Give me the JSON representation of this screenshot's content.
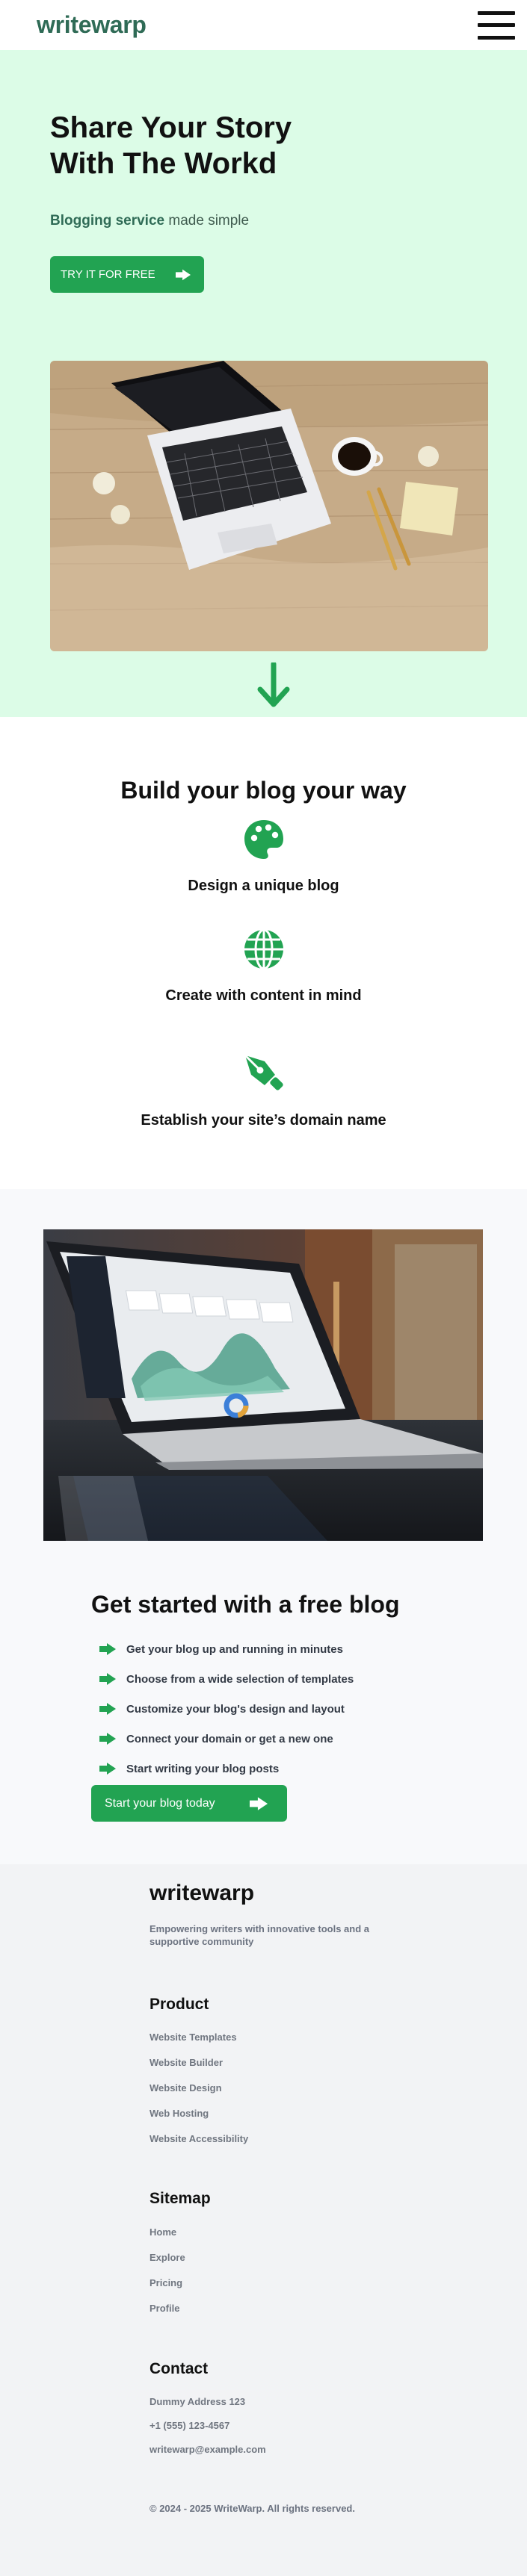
{
  "header": {
    "logo": "writewarp",
    "menu_icon": "hamburger-menu-icon"
  },
  "hero": {
    "title": "Share Your Story With The Workd",
    "subtitle_accent": "Blogging service",
    "subtitle_rest": " made simple",
    "cta_label": "TRY IT FOR FREE",
    "cta_icon": "arrow-right-icon",
    "image": "laptop-on-wooden-desk-with-coffee-and-notepad",
    "scroll_icon": "arrow-down-icon"
  },
  "features": {
    "title": "Build your blog your way",
    "items": [
      {
        "title": "Design a unique blog",
        "icon": "palette-icon"
      },
      {
        "title": "Create with content in mind",
        "icon": "globe-icon"
      },
      {
        "title": "Establish your site’s domain name",
        "icon": "pen-nib-icon"
      }
    ]
  },
  "promo": {
    "image": "laptop-showing-analytics-dashboard",
    "title": "Get started with a free blog",
    "benefits": [
      "Get your blog up and running in minutes",
      "Choose from a wide selection of templates",
      "Customize your blog's design and layout",
      "Connect your domain or get a new one",
      "Start writing your blog posts"
    ],
    "benefit_icon": "arrow-right-icon",
    "cta_label": "Start your blog today",
    "cta_icon": "arrow-right-icon"
  },
  "footer": {
    "logo": "writewarp",
    "tagline": "Empowering writers with innovative tools and a supportive community",
    "product": {
      "heading": "Product",
      "links": [
        "Website Templates",
        "Website Builder",
        "Website Design",
        "Web Hosting",
        "Website Accessibility"
      ]
    },
    "sitemap": {
      "heading": "Sitemap",
      "links": [
        "Home",
        "Explore",
        "Pricing",
        "Profile"
      ]
    },
    "contact": {
      "heading": "Contact",
      "address": "Dummy Address 123",
      "phone": "+1 (555) 123-4567",
      "email": "writewarp@example.com"
    },
    "copyright": "© 2024 - 2025 WriteWarp. All rights reserved."
  },
  "colors": {
    "brand_green": "#22a352",
    "logo_green": "#2f6b56",
    "hero_background": "#dcfce7",
    "footer_background": "#f2f3f5"
  }
}
